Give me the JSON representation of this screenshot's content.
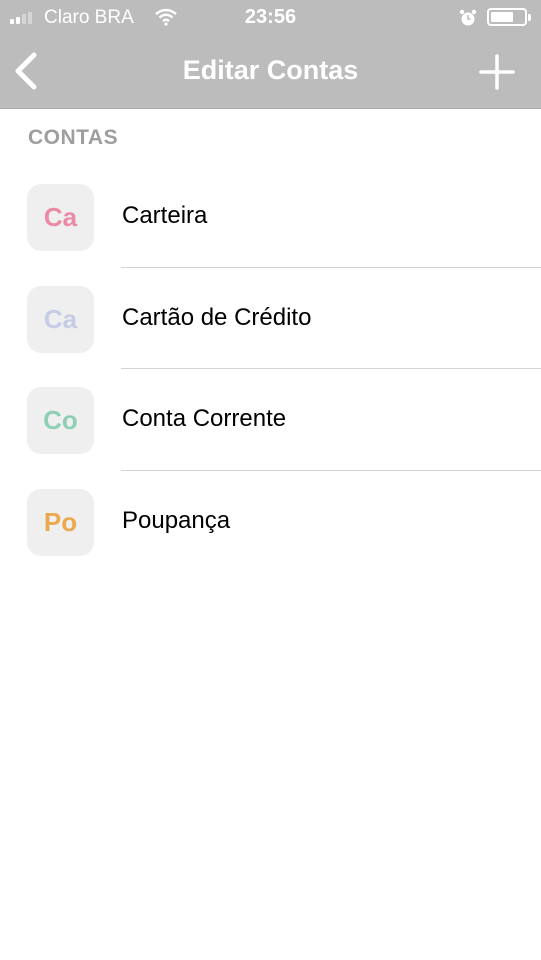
{
  "status_bar": {
    "carrier": "Claro BRA",
    "time": "23:56",
    "signal_bars": 2,
    "signal_max": 4,
    "battery_level": 0.6,
    "icons": [
      "signal-icon",
      "wifi-icon",
      "alarm-icon",
      "battery-icon"
    ]
  },
  "nav": {
    "title": "Editar Contas",
    "back_icon": "chevron-left-icon",
    "add_icon": "plus-icon"
  },
  "section_header": "CONTAS",
  "accounts": [
    {
      "initials": "Ca",
      "name": "Carteira",
      "color": "#ec8aa6"
    },
    {
      "initials": "Ca",
      "name": "Cartão de Crédito",
      "color": "#c6cbe6"
    },
    {
      "initials": "Co",
      "name": "Conta Corrente",
      "color": "#8ecfb5"
    },
    {
      "initials": "Po",
      "name": "Poupança",
      "color": "#eaa94e"
    }
  ]
}
